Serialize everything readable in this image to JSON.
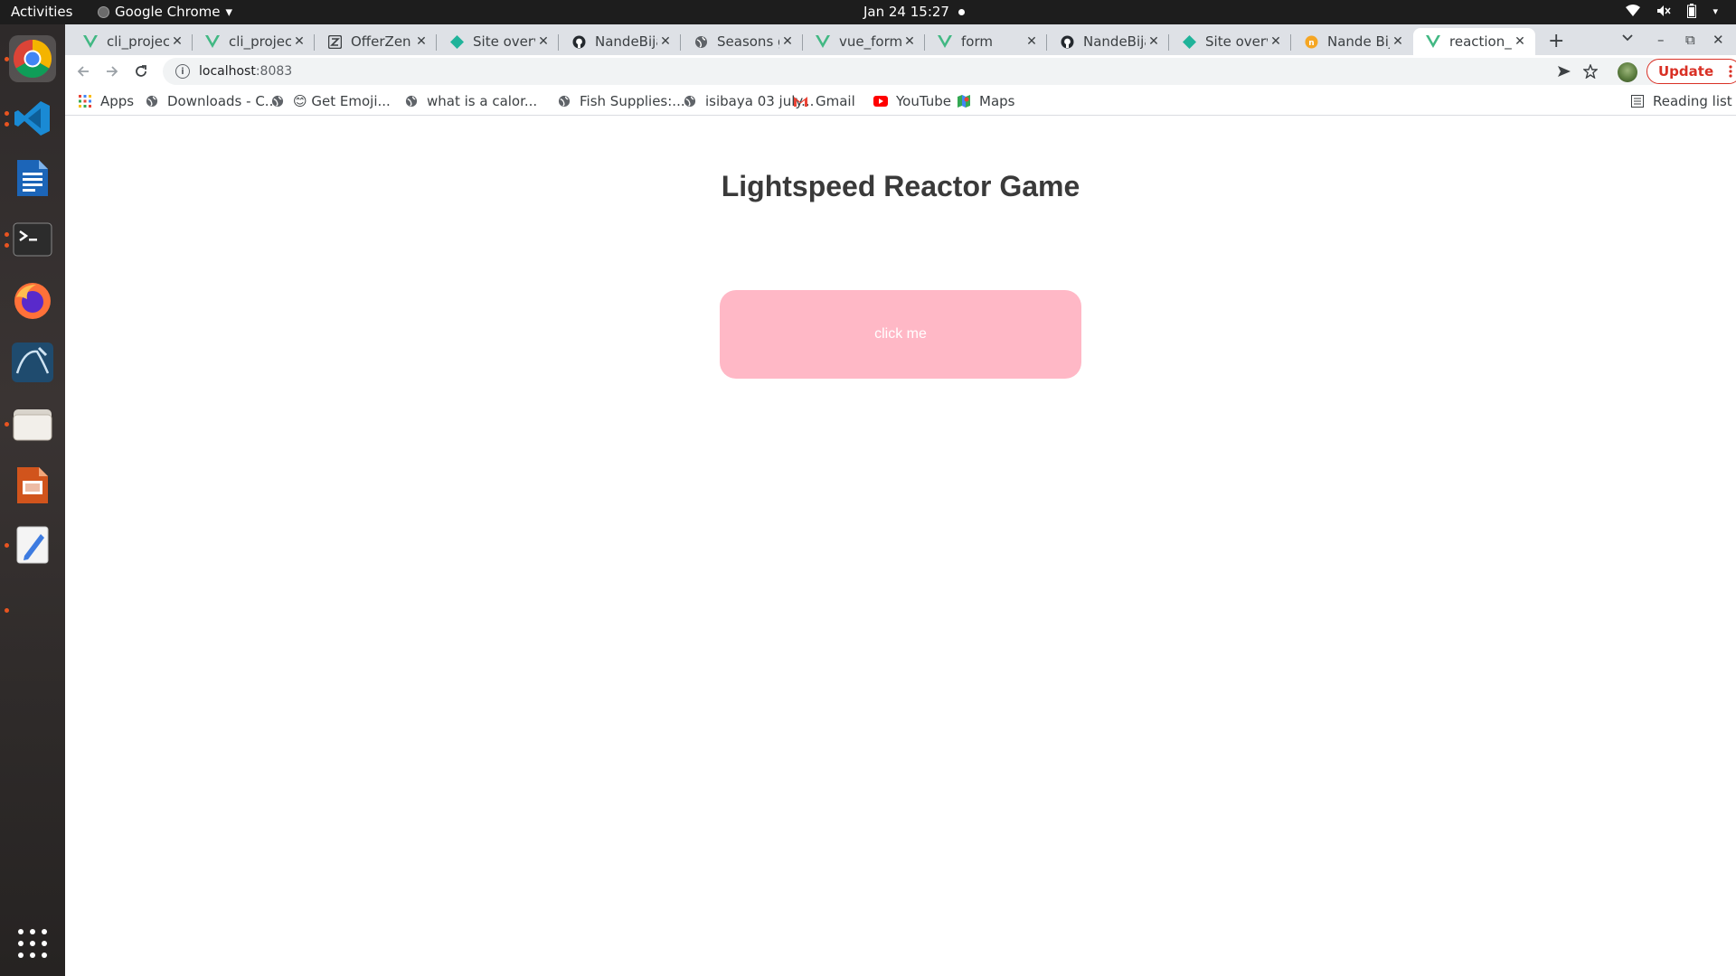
{
  "topbar": {
    "activities": "Activities",
    "app_name": "Google Chrome",
    "clock": "Jan 24  15:27"
  },
  "dock": {
    "items": [
      {
        "name": "Google Chrome",
        "icon": "chrome-icon"
      },
      {
        "name": "Visual Studio Code",
        "icon": "vscode-icon"
      },
      {
        "name": "LibreOffice Writer",
        "icon": "writer-icon"
      },
      {
        "name": "Terminal",
        "icon": "terminal-icon"
      },
      {
        "name": "Firefox",
        "icon": "firefox-icon"
      },
      {
        "name": "MySQL Workbench",
        "icon": "mysql-workbench-icon"
      },
      {
        "name": "Files",
        "icon": "files-icon"
      },
      {
        "name": "LibreOffice Impress",
        "icon": "impress-icon"
      },
      {
        "name": "Text Editor",
        "icon": "text-editor-icon"
      }
    ]
  },
  "tabs": [
    {
      "title": "cli_project",
      "icon": "vue-icon"
    },
    {
      "title": "cli_project",
      "icon": "vue-icon"
    },
    {
      "title": "OfferZen",
      "icon": "offerzen-icon"
    },
    {
      "title": "Site overvi",
      "icon": "netlify-icon"
    },
    {
      "title": "NandeBija",
      "icon": "github-icon"
    },
    {
      "title": "Seasons gi",
      "icon": "globe-icon"
    },
    {
      "title": "vue_forms",
      "icon": "vue-icon"
    },
    {
      "title": "form",
      "icon": "vue-icon"
    },
    {
      "title": "NandeBija",
      "icon": "github-icon"
    },
    {
      "title": "Site overvi",
      "icon": "netlify-icon"
    },
    {
      "title": "Nande Bija",
      "icon": "orange-n-icon"
    },
    {
      "title": "reaction_t",
      "icon": "vue-icon",
      "active": true
    }
  ],
  "toolbar": {
    "url_host": "localhost",
    "url_port": ":8083",
    "update_label": "Update"
  },
  "bookmarks": {
    "apps": "Apps",
    "items": [
      {
        "label": "Downloads - C...",
        "icon": "globe-icon"
      },
      {
        "label": "😊 Get Emoji...",
        "icon": "globe-icon"
      },
      {
        "label": "what is a calor...",
        "icon": "globe-icon"
      },
      {
        "label": "Fish Supplies:...",
        "icon": "globe-icon"
      },
      {
        "label": "isibaya 03 july...",
        "icon": "globe-icon"
      },
      {
        "label": "Gmail",
        "icon": "gmail-icon"
      },
      {
        "label": "YouTube",
        "icon": "youtube-icon"
      },
      {
        "label": "Maps",
        "icon": "maps-icon"
      }
    ],
    "reading_list": "Reading list"
  },
  "page": {
    "title": "Lightspeed Reactor Game",
    "button_label": "click me",
    "button_color": "#ffb8c6"
  }
}
